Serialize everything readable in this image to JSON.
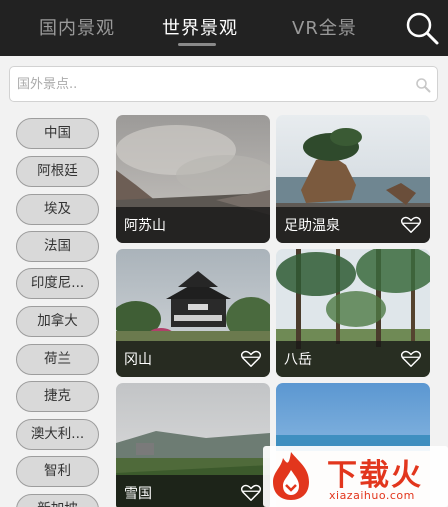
{
  "tabs": [
    {
      "label": "国内景观",
      "active": false
    },
    {
      "label": "世界景观",
      "active": true
    },
    {
      "label": "VR全景",
      "active": false
    }
  ],
  "search": {
    "placeholder": "国外景点.."
  },
  "countries": [
    "中国",
    "阿根廷",
    "埃及",
    "法国",
    "印度尼...",
    "加拿大",
    "荷兰",
    "捷克",
    "澳大利...",
    "智利",
    "新加坡"
  ],
  "cards": [
    {
      "title": "阿苏山",
      "favorite": false
    },
    {
      "title": "足助温泉",
      "favorite": true
    },
    {
      "title": "冈山",
      "favorite": true
    },
    {
      "title": "八岳",
      "favorite": true
    },
    {
      "title": "雪国",
      "favorite": true
    },
    {
      "title": "",
      "favorite": false
    }
  ],
  "watermark": {
    "title": "下载火",
    "url": "xiazaihuo.com"
  },
  "colors": {
    "topbar": "#222222",
    "active_tab": "#ffffff",
    "inactive_tab": "#9a9a9a",
    "pill_bg": "#d9d9d9",
    "brand": "#e2361d"
  }
}
